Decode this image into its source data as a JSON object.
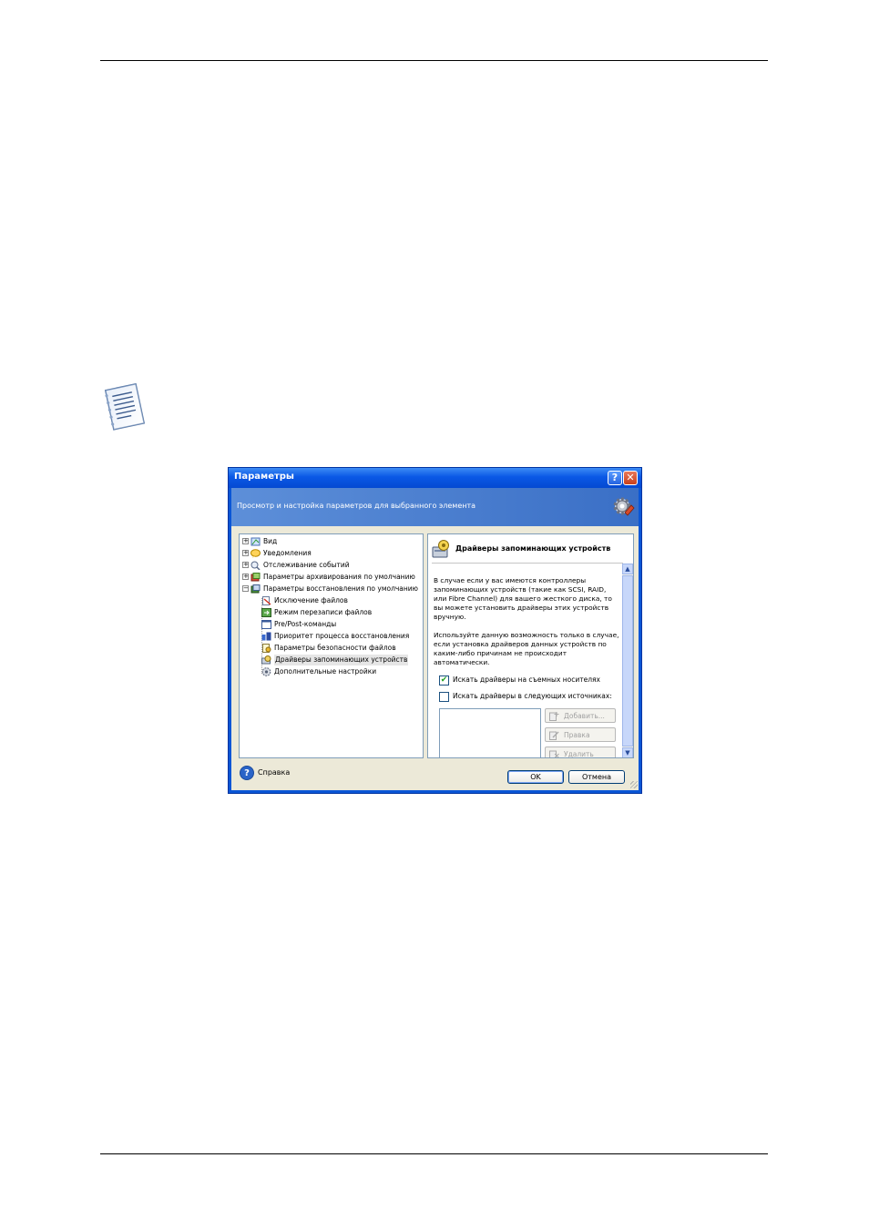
{
  "dialog": {
    "title": "Параметры",
    "help_glyph": "?",
    "close_glyph": "✕",
    "banner_text": "Просмотр и настройка параметров для выбранного элемента",
    "tree": {
      "items": [
        {
          "label": "Вид",
          "expander": "+"
        },
        {
          "label": "Уведомления",
          "expander": "+"
        },
        {
          "label": "Отслеживание событий",
          "expander": "+"
        },
        {
          "label": "Параметры архивирования по умолчанию",
          "expander": "+"
        },
        {
          "label": "Параметры восстановления по умолчанию",
          "expander": "−"
        }
      ],
      "children": [
        {
          "label": "Исключение файлов"
        },
        {
          "label": "Режим перезаписи файлов"
        },
        {
          "label": "Pre/Post-команды"
        },
        {
          "label": "Приоритет процесса восстановления"
        },
        {
          "label": "Параметры безопасности файлов"
        },
        {
          "label": "Драйверы запоминающих устройств",
          "selected": true
        },
        {
          "label": "Дополнительные настройки"
        }
      ]
    },
    "panel": {
      "title": "Драйверы запоминающих устройств",
      "paragraph1": "В случае если у вас имеются контроллеры запоминающих устройств (такие как SCSI, RAID, или Fibre Channel) для вашего жесткого диска, то вы можете установить драйверы этих устройств вручную.",
      "paragraph2": "Используйте данную возможность только в случае, если установка драйверов данных устройств по каким-либо причинам не происходит автоматически.",
      "checkbox1": {
        "label": "Искать драйверы на съемных носителях",
        "checked": true
      },
      "checkbox2": {
        "label": "Искать драйверы в следующих источниках:",
        "checked": false
      },
      "buttons": {
        "add": "Добавить...",
        "edit": "Правка",
        "remove": "Удалить"
      }
    },
    "footer": {
      "help_label": "Справка",
      "ok_label": "OK",
      "cancel_label": "Отмена"
    },
    "colors": {
      "title_bar": "#0a58e6",
      "banner": "#4b7fcf",
      "client": "#ece9d8"
    }
  }
}
